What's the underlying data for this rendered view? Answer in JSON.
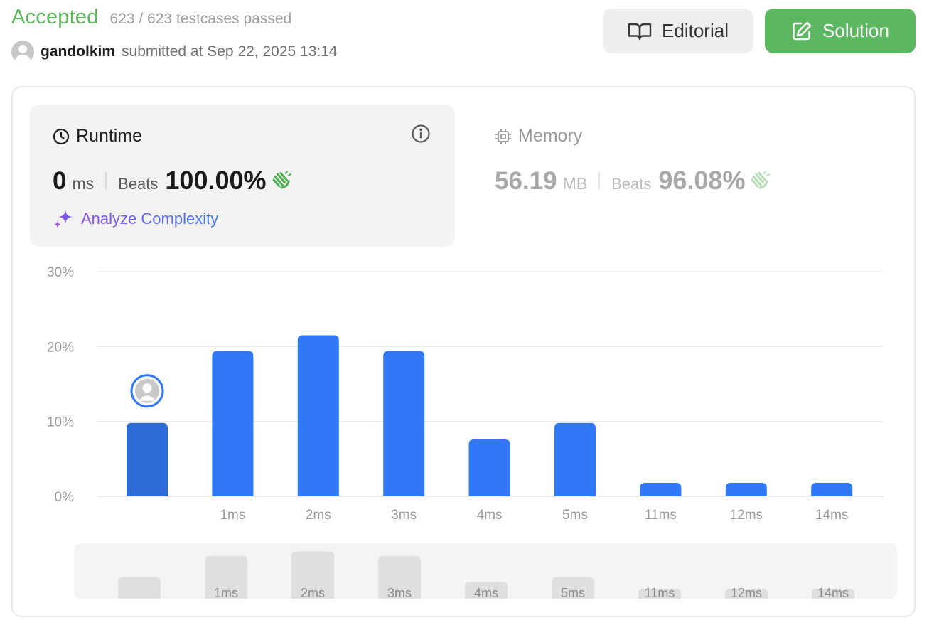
{
  "header": {
    "status": "Accepted",
    "testcases": "623 / 623 testcases passed",
    "username": "gandolkim",
    "submitted_text": "submitted at Sep 22, 2025 13:14",
    "editorial_label": "Editorial",
    "solution_label": "Solution"
  },
  "runtime": {
    "title": "Runtime",
    "value": "0",
    "unit": "ms",
    "beats_label": "Beats",
    "beats_value": "100.00%",
    "analyze_label": "Analyze Complexity"
  },
  "memory": {
    "title": "Memory",
    "value": "56.19",
    "unit": "MB",
    "beats_label": "Beats",
    "beats_value": "96.08%"
  },
  "colors": {
    "accepted": "#5cb85c",
    "bar": "#3178f6",
    "bar_selected": "#2c6ad8",
    "solution_button": "#5cb860"
  },
  "icons": {
    "editorial": "book-open-icon",
    "solution": "edit-icon",
    "runtime": "clock-icon",
    "memory": "chip-icon",
    "info": "info-icon",
    "analyze": "sparkle-icon",
    "beats": "clapping-hands-icon"
  },
  "chart_data": {
    "type": "bar",
    "title": "",
    "xlabel": "",
    "ylabel": "",
    "categories": [
      "",
      "1ms",
      "2ms",
      "3ms",
      "4ms",
      "5ms",
      "11ms",
      "12ms",
      "14ms"
    ],
    "values": [
      9.8,
      19.4,
      21.5,
      19.4,
      7.6,
      9.8,
      1.8,
      1.8,
      1.8
    ],
    "selected_index": 0,
    "y_ticks": [
      "0%",
      "10%",
      "20%",
      "30%"
    ],
    "ylim": [
      0,
      30
    ],
    "grid": true,
    "legend": "none"
  }
}
